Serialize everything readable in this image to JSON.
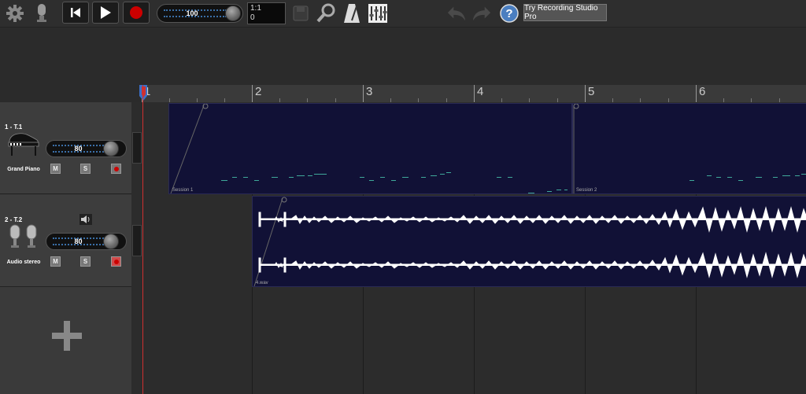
{
  "toolbar": {
    "master_volume": "100",
    "counter_bar": "1:1",
    "counter_tick": "0",
    "pro_label": "Try Recording Studio Pro"
  },
  "ruler": {
    "bars": [
      "1",
      "2",
      "3",
      "4",
      "5",
      "6"
    ]
  },
  "tracks": [
    {
      "name": "1 - T.1",
      "instrument": "Grand Piano",
      "volume": "80",
      "mute": "M",
      "solo": "S",
      "armed": false
    },
    {
      "name": "2 - T.2",
      "instrument": "Audio stereo",
      "volume": "80",
      "mute": "M",
      "solo": "S",
      "armed": true
    }
  ],
  "clips": {
    "session1": "Session 1",
    "session2": "Session 2",
    "audio": "4.wav"
  },
  "colors": {
    "clip_bg": "#111136",
    "midi_note": "#3fa89a",
    "playhead": "#d03030",
    "record": "#cc0000"
  }
}
